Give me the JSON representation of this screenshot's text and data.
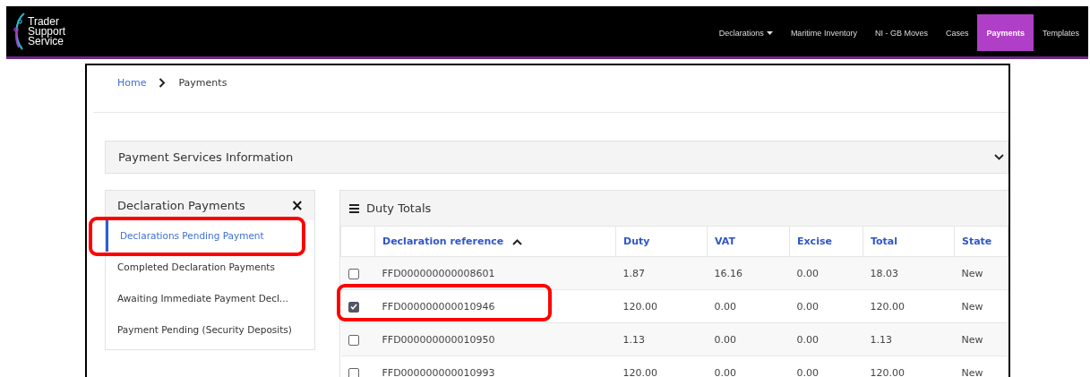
{
  "logo": {
    "lines": [
      "Trader",
      "Support",
      "Service"
    ]
  },
  "nav": [
    {
      "label": "Declarations",
      "dropdown": true,
      "selected": false
    },
    {
      "label": "Maritime Inventory",
      "dropdown": false,
      "selected": false
    },
    {
      "label": "NI - GB Moves",
      "dropdown": false,
      "selected": false
    },
    {
      "label": "Cases",
      "dropdown": false,
      "selected": false
    },
    {
      "label": "Payments",
      "dropdown": false,
      "selected": true
    },
    {
      "label": "Templates",
      "dropdown": false,
      "selected": false
    }
  ],
  "breadcrumb": [
    {
      "label": "Home",
      "link": true
    },
    {
      "label": "Payments",
      "link": false
    }
  ],
  "accordion": {
    "title": "Payment Services Information",
    "expanded": false
  },
  "sidebar": {
    "title": "Declaration Payments",
    "close": "×",
    "items": [
      {
        "label": "Declarations Pending Payment",
        "selected": true,
        "highlighted": true
      },
      {
        "label": "Completed Declaration Payments",
        "selected": false,
        "highlighted": false
      },
      {
        "label": "Awaiting Immediate Payment Decl...",
        "selected": false,
        "highlighted": false
      },
      {
        "label": "Payment Pending (Security Deposits)",
        "selected": false,
        "highlighted": false
      }
    ]
  },
  "table": {
    "title": "Duty Totals",
    "columns": [
      {
        "label": "Declaration reference",
        "sorted": true
      },
      {
        "label": "Duty",
        "sorted": false
      },
      {
        "label": "VAT",
        "sorted": false
      },
      {
        "label": "Excise",
        "sorted": false
      },
      {
        "label": "Total",
        "sorted": false
      },
      {
        "label": "State",
        "sorted": false
      }
    ],
    "rows": [
      {
        "checked": false,
        "highlighted": false,
        "cells": [
          "FFD000000000008601",
          "1.87",
          "16.16",
          "0.00",
          "18.03",
          "New"
        ]
      },
      {
        "checked": true,
        "highlighted": true,
        "cells": [
          "FFD000000000010946",
          "120.00",
          "0.00",
          "0.00",
          "120.00",
          "New"
        ]
      },
      {
        "checked": false,
        "highlighted": false,
        "cells": [
          "FFD000000000010950",
          "1.13",
          "0.00",
          "0.00",
          "1.13",
          "New"
        ]
      },
      {
        "checked": false,
        "highlighted": false,
        "cells": [
          "FFD000000000010993",
          "120.00",
          "0.00",
          "0.00",
          "120.00",
          "New"
        ]
      }
    ]
  }
}
